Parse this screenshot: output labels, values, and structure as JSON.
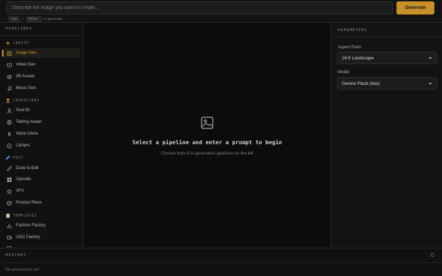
{
  "prompt": {
    "placeholder": "Describe the image you want to create...",
    "generate_label": "Generate"
  },
  "hint": {
    "key1": "Cmd",
    "plus": "+",
    "key2": "Enter",
    "suffix": "to generate"
  },
  "sidebar": {
    "title": "PIPELINES",
    "sections": {
      "create": {
        "label": "CREATE",
        "icon": "sparkle-icon"
      },
      "characters": {
        "label": "CHARACTERS",
        "icon": "character-icon"
      },
      "edit": {
        "label": "EDIT",
        "icon": "pencil-icon"
      },
      "templates": {
        "label": "TEMPLATES",
        "icon": "clipboard-icon"
      }
    },
    "items": {
      "image_gen": "Image Gen",
      "video_gen": "Video Gen",
      "assets_3d": "3D Assets",
      "music_gen": "Music Gen",
      "soul_id": "Soul ID",
      "talking_avatar": "Talking Avatar",
      "voice_clone": "Voice Clone",
      "lipsync": "Lipsync",
      "draw_to_edit": "Draw to Edit",
      "upscale": "Upscale",
      "vfx": "VFX",
      "product_place": "Product Place",
      "fashion_factory": "Fashion Factory",
      "ugc_factory": "UGC Factory"
    },
    "active": "image_gen"
  },
  "main": {
    "title": "Select a pipeline and enter a prompt to begin",
    "subtitle": "Choose from 9 AI generation pipelines on the left"
  },
  "params": {
    "title": "PARAMETERS",
    "aspect_label": "Aspect Ratio",
    "aspect_value": "16:9 Landscape",
    "model_label": "Model",
    "model_value": "Gemini Flash (fast)"
  },
  "history": {
    "title": "HISTORY",
    "empty": "No generations yet"
  },
  "colors": {
    "accent": "#d99a2b",
    "button": "#c9902a",
    "background": "#0c0c0c"
  }
}
